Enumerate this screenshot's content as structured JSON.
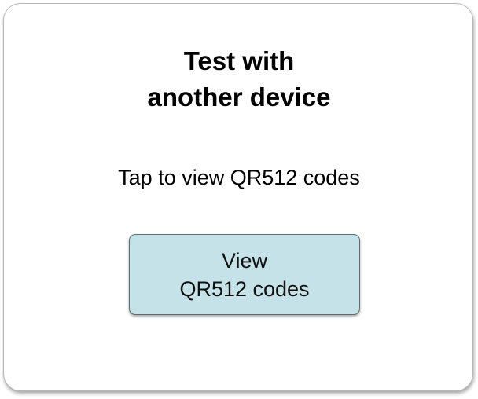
{
  "card": {
    "title_line1": "Test with",
    "title_line2": "another device",
    "subtitle": "Tap to view QR512 codes",
    "button": {
      "line1": "View",
      "line2": "QR512 codes",
      "color": "#c4e2e8"
    }
  }
}
